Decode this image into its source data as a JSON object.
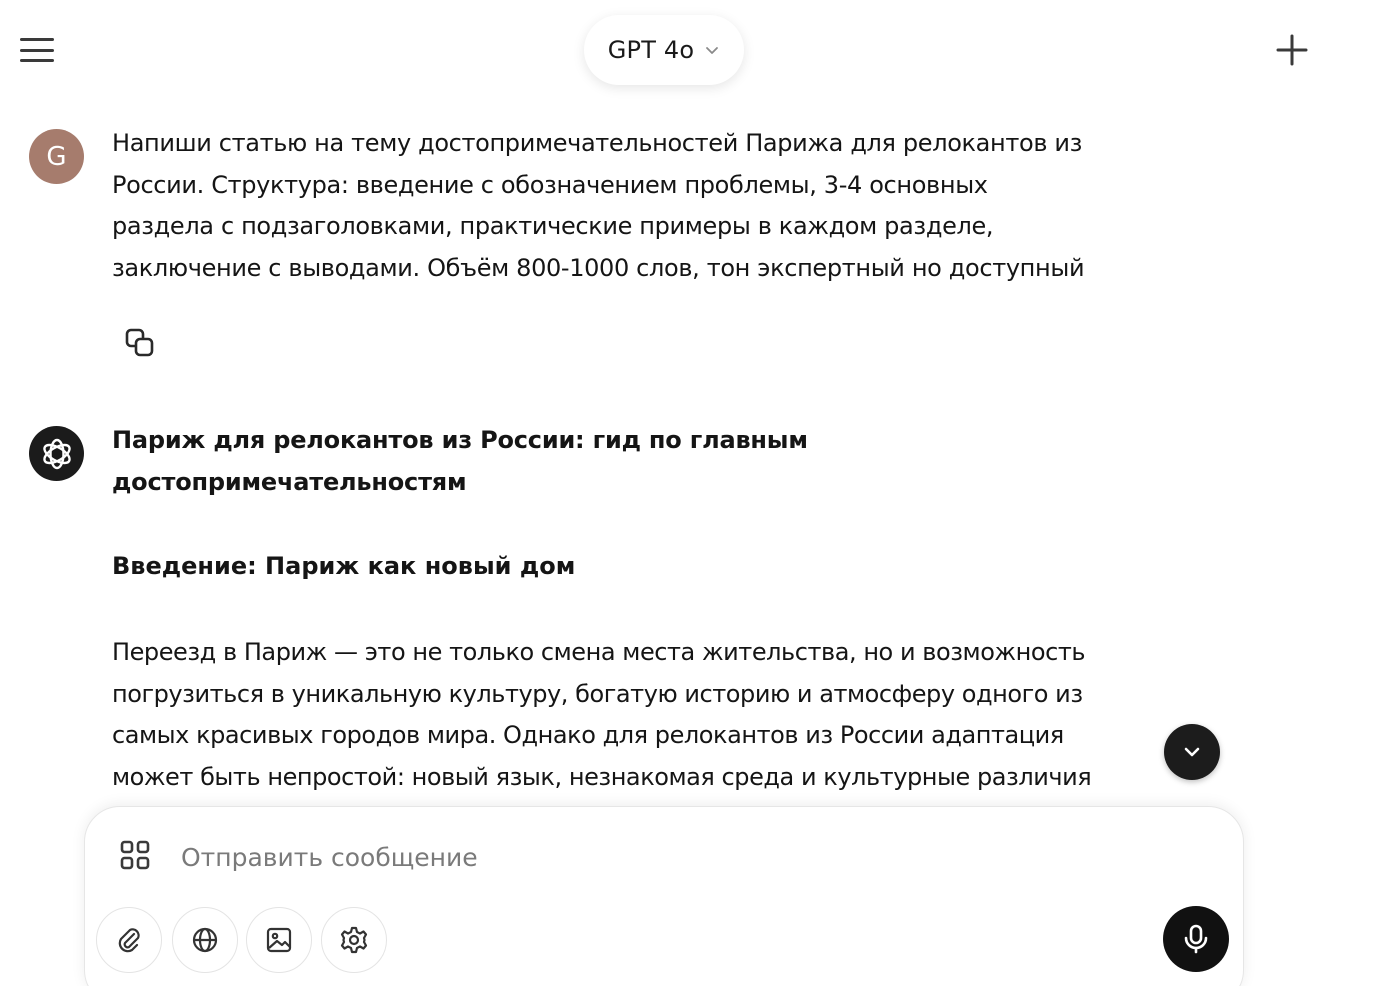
{
  "header": {
    "model_name": "GPT 4o"
  },
  "icons": {
    "menu": "hamburger-menu-icon",
    "chevron": "chevron-down-icon",
    "new_chat": "plus-icon",
    "copy": "copy-icon",
    "ai_avatar": "openai-logo-icon",
    "scroll_down": "chevron-down-icon",
    "apps": "apps-grid-icon",
    "attach": "paperclip-icon",
    "web": "globe-icon",
    "image": "image-icon",
    "tools": "gear-icon",
    "voice": "microphone-icon"
  },
  "colors": {
    "user_avatar_bg": "#a67c6d",
    "ai_avatar_bg": "#1b1b1b",
    "mic_button_bg": "#111111"
  },
  "user_message": {
    "avatar_initial": "G",
    "lines": [
      "Напиши статью на тему достопримечательностей Парижа для релокантов из",
      "России. Структура: введение с обозначением проблемы, 3-4 основных",
      "раздела с подзаголовками, практические примеры в каждом разделе,",
      "заключение с выводами. Объём 800-1000 слов, тон экспертный но доступный"
    ]
  },
  "assistant_message": {
    "title": "Париж для релокантов из России: гид по главным достопримечательностям",
    "intro_heading": "Введение: Париж как новый дом",
    "intro_lines": [
      "Переезд в Париж — это не только смена места жительства, но и возможность",
      "погрузиться в уникальную культуру, богатую историю и атмосферу одного из",
      "самых красивых городов мира. Однако для релокантов из России адаптация",
      "может быть непростой: новый язык, незнакомая среда и культурные различия"
    ]
  },
  "composer": {
    "placeholder": "Отправить сообщение"
  }
}
